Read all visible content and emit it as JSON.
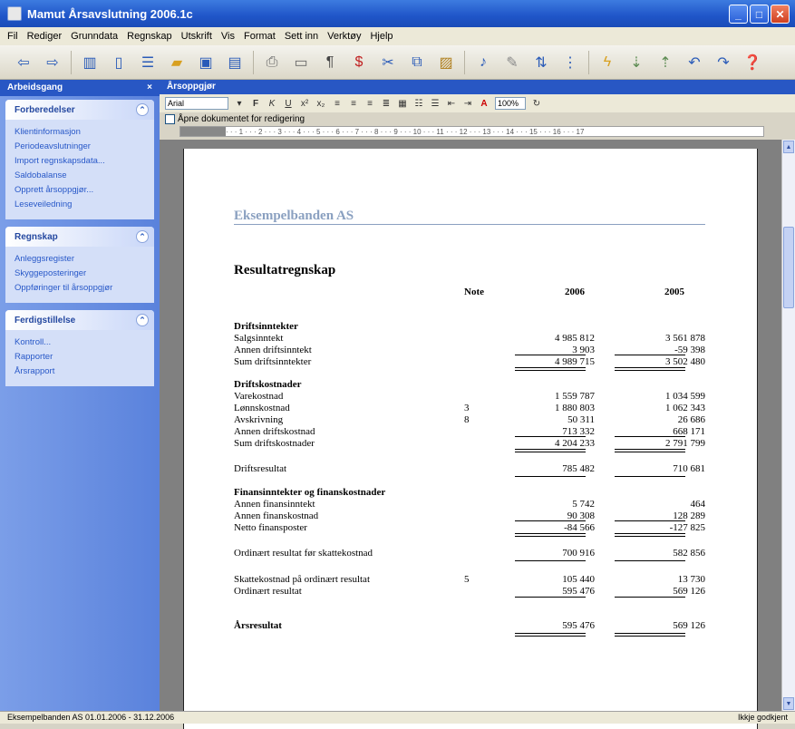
{
  "window": {
    "title": "Mamut Årsavslutning 2006.1c"
  },
  "menu": [
    "Fil",
    "Rediger",
    "Grunndata",
    "Regnskap",
    "Utskrift",
    "Vis",
    "Format",
    "Sett inn",
    "Verktøy",
    "Hjelp"
  ],
  "sidebar": {
    "title": "Arbeidsgang",
    "panels": [
      {
        "title": "Forberedelser",
        "items": [
          "Klientinformasjon",
          "Periodeavslutninger",
          "Import regnskapsdata...",
          "Saldobalanse",
          "Opprett årsoppgjør...",
          "Leseveiledning"
        ]
      },
      {
        "title": "Regnskap",
        "items": [
          "Anleggsregister",
          "Skyggeposteringer",
          "Oppføringer til årsoppgjør"
        ]
      },
      {
        "title": "Ferdigstillelse",
        "items": [
          "Kontroll...",
          "Rapporter",
          "Årsrapport"
        ]
      }
    ]
  },
  "doc": {
    "panel_title": "Årsoppgjør",
    "font": "Arial",
    "zoom": "100%",
    "checkbox_label": "Åpne dokumentet for redigering",
    "ruler": "· · · 1 · · · 2 · · · 3 · · · 4 · · · 5 · · · 6 · · · 7 · · · 8 · · · 9 · · · 10 · · · 11 · · · 12 · · · 13 · · · 14 · · · 15 · · · 16 · · · 17",
    "company": "Eksempelbanden AS",
    "report_title": "Resultatregnskap",
    "col_note": "Note",
    "col_2006": "2006",
    "col_2005": "2005",
    "rows": [
      {
        "label": "Driftsinntekter",
        "bold": true
      },
      {
        "label": "Salgsinntekt",
        "v1": "4 985 812",
        "v2": "3 561 878"
      },
      {
        "label": "Annen driftsinntekt",
        "v1": "3 903",
        "v2": "-59 398"
      },
      {
        "label": "Sum driftsinntekter",
        "v1": "4 989 715",
        "v2": "3 502 480"
      },
      {
        "label": "Driftskostnader",
        "bold": true
      },
      {
        "label": "Varekostnad",
        "v1": "1 559 787",
        "v2": "1 034 599"
      },
      {
        "label": "Lønnskostnad",
        "note": "3",
        "v1": "1 880 803",
        "v2": "1 062 343"
      },
      {
        "label": "Avskrivning",
        "note": "8",
        "v1": "50 311",
        "v2": "26 686"
      },
      {
        "label": "Annen driftskostnad",
        "v1": "713 332",
        "v2": "668 171"
      },
      {
        "label": "Sum driftskostnader",
        "v1": "4 204 233",
        "v2": "2 791 799"
      },
      {
        "label": "Driftsresultat",
        "v1": "785 482",
        "v2": "710 681"
      },
      {
        "label": "Finansinntekter og finanskostnader",
        "bold": true
      },
      {
        "label": "Annen finansinntekt",
        "v1": "5 742",
        "v2": "464"
      },
      {
        "label": "Annen finanskostnad",
        "v1": "90 308",
        "v2": "128 289"
      },
      {
        "label": "Netto finansposter",
        "v1": "-84 566",
        "v2": "-127 825"
      },
      {
        "label": "Ordinært resultat før skattekostnad",
        "v1": "700 916",
        "v2": "582 856"
      },
      {
        "label": "Skattekostnad på ordinært resultat",
        "note": "5",
        "v1": "105 440",
        "v2": "13 730"
      },
      {
        "label": "Ordinært resultat",
        "v1": "595 476",
        "v2": "569 126"
      },
      {
        "label": "Årsresultat",
        "bold": true,
        "v1": "595 476",
        "v2": "569 126"
      }
    ]
  },
  "status": {
    "left": "Eksempelbanden AS 01.01.2006 - 31.12.2006",
    "right": "Ikkje godkjent"
  }
}
